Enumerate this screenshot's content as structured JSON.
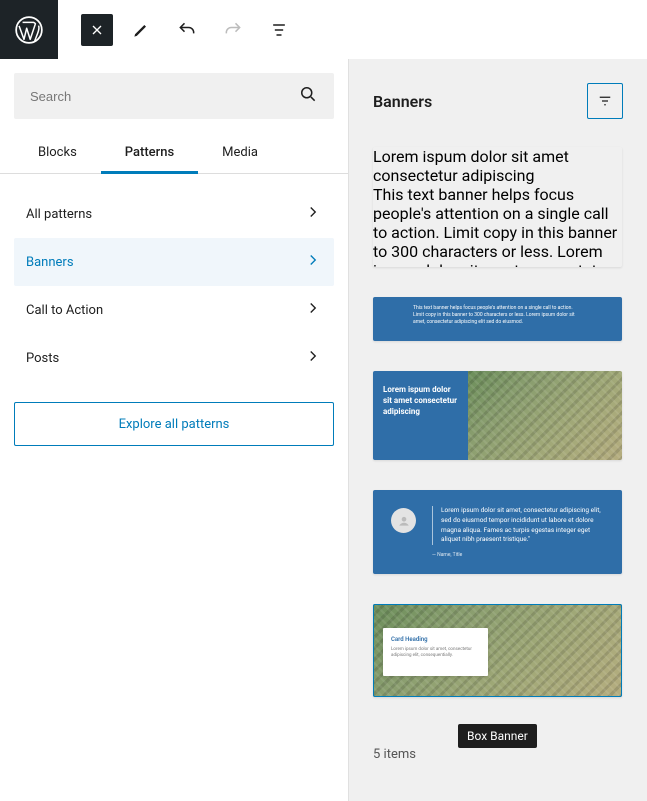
{
  "search": {
    "placeholder": "Search"
  },
  "tabs": [
    "Blocks",
    "Patterns",
    "Media"
  ],
  "active_tab": 1,
  "categories": [
    {
      "label": "All patterns"
    },
    {
      "label": "Banners"
    },
    {
      "label": "Call to Action"
    },
    {
      "label": "Posts"
    }
  ],
  "selected_category": 1,
  "explore_label": "Explore all patterns",
  "heading": "Banners",
  "pattern1": {
    "title": "Lorem ispum dolor sit amet consectetur adipiscing",
    "body": "This text banner helps focus people's attention on a single call to action. Limit copy in this banner to 300 characters or less. Lorem ipsum dolor sit amet, consectetur adipiscing elit sed do eiusmod."
  },
  "pattern2": {
    "body": "This text banner helps focus people's attention on a single call to action. Limit copy in this banner to 300 characters or less. Lorem ipsum dolor sit amet, consectetur adipiscing elit sed do eiusmod."
  },
  "pattern3": {
    "title": "Lorem ispum dolor sit amet consectetur adipiscing"
  },
  "pattern4": {
    "quote": "Lorem ipsum dolor sit amet, consectetur adipiscing elit, sed do eiusmod tempor incididunt ut labore et dolore magna aliqua. Fames ac turpis egestas integer eget aliquet nibh praesent tristique.\"",
    "attribution": "— Name, Title"
  },
  "pattern5": {
    "heading": "Card Heading",
    "text": "Lorem ipsum dolor sit amet, consectetur adipiscing elit, consequentially."
  },
  "count_label": "5 items",
  "tooltip_label": "Box Banner"
}
